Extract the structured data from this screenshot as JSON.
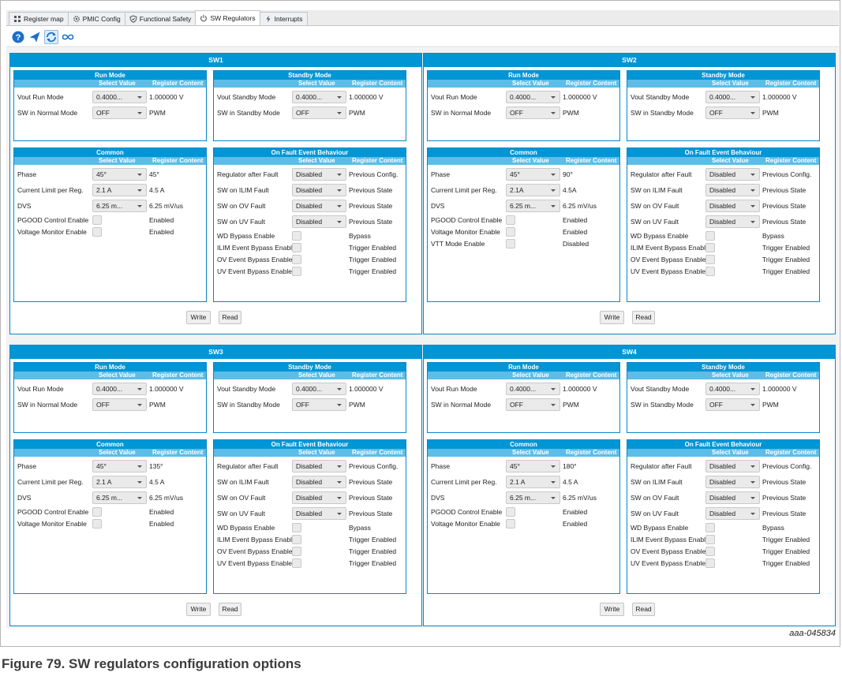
{
  "tabs": [
    {
      "label": "Register map",
      "icon": "grid-icon",
      "active": false
    },
    {
      "label": "PMIC Config",
      "icon": "gear-icon",
      "active": false
    },
    {
      "label": "Functional Safety",
      "icon": "shield-icon",
      "active": false
    },
    {
      "label": "SW Regulators",
      "icon": "power-icon",
      "active": true
    },
    {
      "label": "Interrupts",
      "icon": "lightning-icon",
      "active": false
    }
  ],
  "toolbar": {
    "buttons": [
      "help-icon",
      "send-icon",
      "sync-icon",
      "infinity-icon"
    ],
    "selected": "sync-icon"
  },
  "columns": {
    "select": "Select Value",
    "register": "Register Content"
  },
  "sections_titles": {
    "run": "Run Mode",
    "standby": "Standby Mode",
    "common": "Common",
    "fault": "On Fault Event Behaviour"
  },
  "buttons": {
    "write": "Write",
    "read": "Read"
  },
  "regulators": [
    {
      "name": "SW1",
      "run": [
        {
          "label": "Vout Run Mode",
          "select": "0.4000...",
          "value": "1.000000 V"
        },
        {
          "label": "SW in Normal Mode",
          "select": "OFF",
          "value": "PWM"
        }
      ],
      "standby": [
        {
          "label": "Vout Standby Mode",
          "select": "0.4000...",
          "value": "1.000000 V"
        },
        {
          "label": "SW in Standby Mode",
          "select": "OFF",
          "value": "PWM"
        }
      ],
      "common": [
        {
          "label": "Phase",
          "select": "45°",
          "value": "45°"
        },
        {
          "label": "Current Limit per Reg.",
          "select": "2.1 A",
          "value": "4.5 A"
        },
        {
          "label": "DVS",
          "select": "6.25 m...",
          "value": "6.25 mV/us"
        }
      ],
      "common_checks": [
        {
          "label": "PGOOD Control Enable",
          "value": "Enabled"
        },
        {
          "label": "Voltage Monitor Enable",
          "value": "Enabled"
        }
      ],
      "fault": [
        {
          "label": "Regulator after Fault",
          "select": "Disabled",
          "value": "Previous Config."
        },
        {
          "label": "SW on ILIM Fault",
          "select": "Disabled",
          "value": "Previous State"
        },
        {
          "label": "SW on OV Fault",
          "select": "Disabled",
          "value": "Previous State"
        },
        {
          "label": "SW on UV Fault",
          "select": "Disabled",
          "value": "Previous State"
        }
      ],
      "fault_checks": [
        {
          "label": "WD Bypass Enable",
          "value": "Bypass"
        },
        {
          "label": "ILIM Event Bypass Enable",
          "value": "Trigger Enabled"
        },
        {
          "label": "OV Event Bypass Enable",
          "value": "Trigger Enabled"
        },
        {
          "label": "UV Event Bypass Enable",
          "value": "Trigger Enabled"
        }
      ]
    },
    {
      "name": "SW2",
      "run": [
        {
          "label": "Vout Run Mode",
          "select": "0.4000...",
          "value": "1.000000 V"
        },
        {
          "label": "SW in Normal Mode",
          "select": "OFF",
          "value": "PWM"
        }
      ],
      "standby": [
        {
          "label": "Vout Standby Mode",
          "select": "0.4000...",
          "value": "1.000000 V"
        },
        {
          "label": "SW in Standby Mode",
          "select": "OFF",
          "value": "PWM"
        }
      ],
      "common": [
        {
          "label": "Phase",
          "select": "45°",
          "value": "90°"
        },
        {
          "label": "Current Limit per Reg.",
          "select": "2.1A",
          "value": "4.5A"
        },
        {
          "label": "DVS",
          "select": "6.25 m...",
          "value": "6.25 mV/us"
        }
      ],
      "common_checks": [
        {
          "label": "PGOOD Control Enable",
          "value": "Enabled"
        },
        {
          "label": "Voltage Monitor Enable",
          "value": "Enabled"
        },
        {
          "label": "VTT Mode Enable",
          "value": "Disabled"
        }
      ],
      "fault": [
        {
          "label": "Regulator after Fault",
          "select": "Disabled",
          "value": "Previous Config."
        },
        {
          "label": "SW on ILIM Fault",
          "select": "Disabled",
          "value": "Previous State"
        },
        {
          "label": "SW on OV Fault",
          "select": "Disabled",
          "value": "Previous State"
        },
        {
          "label": "SW on UV Fault",
          "select": "Disabled",
          "value": "Previous State"
        }
      ],
      "fault_checks": [
        {
          "label": "WD Bypass Enable",
          "value": "Bypass"
        },
        {
          "label": "ILIM Event Bypass Enable",
          "value": "Trigger Enabled"
        },
        {
          "label": "OV Event Bypass Enable",
          "value": "Trigger Enabled"
        },
        {
          "label": "UV Event Bypass Enable",
          "value": "Trigger Enabled"
        }
      ]
    },
    {
      "name": "SW3",
      "run": [
        {
          "label": "Vout Run Mode",
          "select": "0.4000...",
          "value": "1.000000 V"
        },
        {
          "label": "SW in Normal Mode",
          "select": "OFF",
          "value": "PWM"
        }
      ],
      "standby": [
        {
          "label": "Vout Standby Mode",
          "select": "0.4000...",
          "value": "1.000000 V"
        },
        {
          "label": "SW in Standby Mode",
          "select": "OFF",
          "value": "PWM"
        }
      ],
      "common": [
        {
          "label": "Phase",
          "select": "45°",
          "value": "135°"
        },
        {
          "label": "Current Limit per Reg.",
          "select": "2.1 A",
          "value": "4.5 A"
        },
        {
          "label": "DVS",
          "select": "6.25 m...",
          "value": "6.25 mV/us"
        }
      ],
      "common_checks": [
        {
          "label": "PGOOD Control Enable",
          "value": "Enabled"
        },
        {
          "label": "Voltage Monitor Enable",
          "value": "Enabled"
        }
      ],
      "fault": [
        {
          "label": "Regulator after Fault",
          "select": "Disabled",
          "value": "Previous Config."
        },
        {
          "label": "SW on ILIM Fault",
          "select": "Disabled",
          "value": "Previous State"
        },
        {
          "label": "SW on OV Fault",
          "select": "Disabled",
          "value": "Previous State"
        },
        {
          "label": "SW on UV Fault",
          "select": "Disabled",
          "value": "Previous State"
        }
      ],
      "fault_checks": [
        {
          "label": "WD Bypass Enable",
          "value": "Bypass"
        },
        {
          "label": "ILIM Event Bypass Enable",
          "value": "Trigger Enabled"
        },
        {
          "label": "OV Event Bypass Enable",
          "value": "Trigger Enabled"
        },
        {
          "label": "UV Event Bypass Enable",
          "value": "Trigger Enabled"
        }
      ]
    },
    {
      "name": "SW4",
      "run": [
        {
          "label": "Vout Run Mode",
          "select": "0.4000...",
          "value": "1.000000 V"
        },
        {
          "label": "SW in Normal Mode",
          "select": "OFF",
          "value": "PWM"
        }
      ],
      "standby": [
        {
          "label": "Vout Standby Mode",
          "select": "0.4000...",
          "value": "1.000000 V"
        },
        {
          "label": "SW in Standby Mode",
          "select": "OFF",
          "value": "PWM"
        }
      ],
      "common": [
        {
          "label": "Phase",
          "select": "45°",
          "value": "180°"
        },
        {
          "label": "Current Limit per Reg.",
          "select": "2.1 A",
          "value": "4.5 A"
        },
        {
          "label": "DVS",
          "select": "6.25 m...",
          "value": "6.25 mV/us"
        }
      ],
      "common_checks": [
        {
          "label": "PGOOD Control Enable",
          "value": "Enabled"
        },
        {
          "label": "Voltage Monitor Enable",
          "value": "Enabled"
        }
      ],
      "fault": [
        {
          "label": "Regulator after Fault",
          "select": "Disabled",
          "value": "Previous Config."
        },
        {
          "label": "SW on ILIM Fault",
          "select": "Disabled",
          "value": "Previous State"
        },
        {
          "label": "SW on OV Fault",
          "select": "Disabled",
          "value": "Previous State"
        },
        {
          "label": "SW on UV Fault",
          "select": "Disabled",
          "value": "Previous State"
        }
      ],
      "fault_checks": [
        {
          "label": "WD Bypass Enable",
          "value": "Bypass"
        },
        {
          "label": "ILIM Event Bypass Enable",
          "value": "Trigger Enabled"
        },
        {
          "label": "OV Event Bypass Enable",
          "value": "Trigger Enabled"
        },
        {
          "label": "UV Event Bypass Enable",
          "value": "Trigger Enabled"
        }
      ]
    }
  ],
  "figure_id": "aaa-045834",
  "caption": "Figure 79.  SW regulators configuration options",
  "colors": {
    "panel_header": "#0096d6",
    "column_header": "#5cbde8",
    "border": "#0a86c8"
  }
}
